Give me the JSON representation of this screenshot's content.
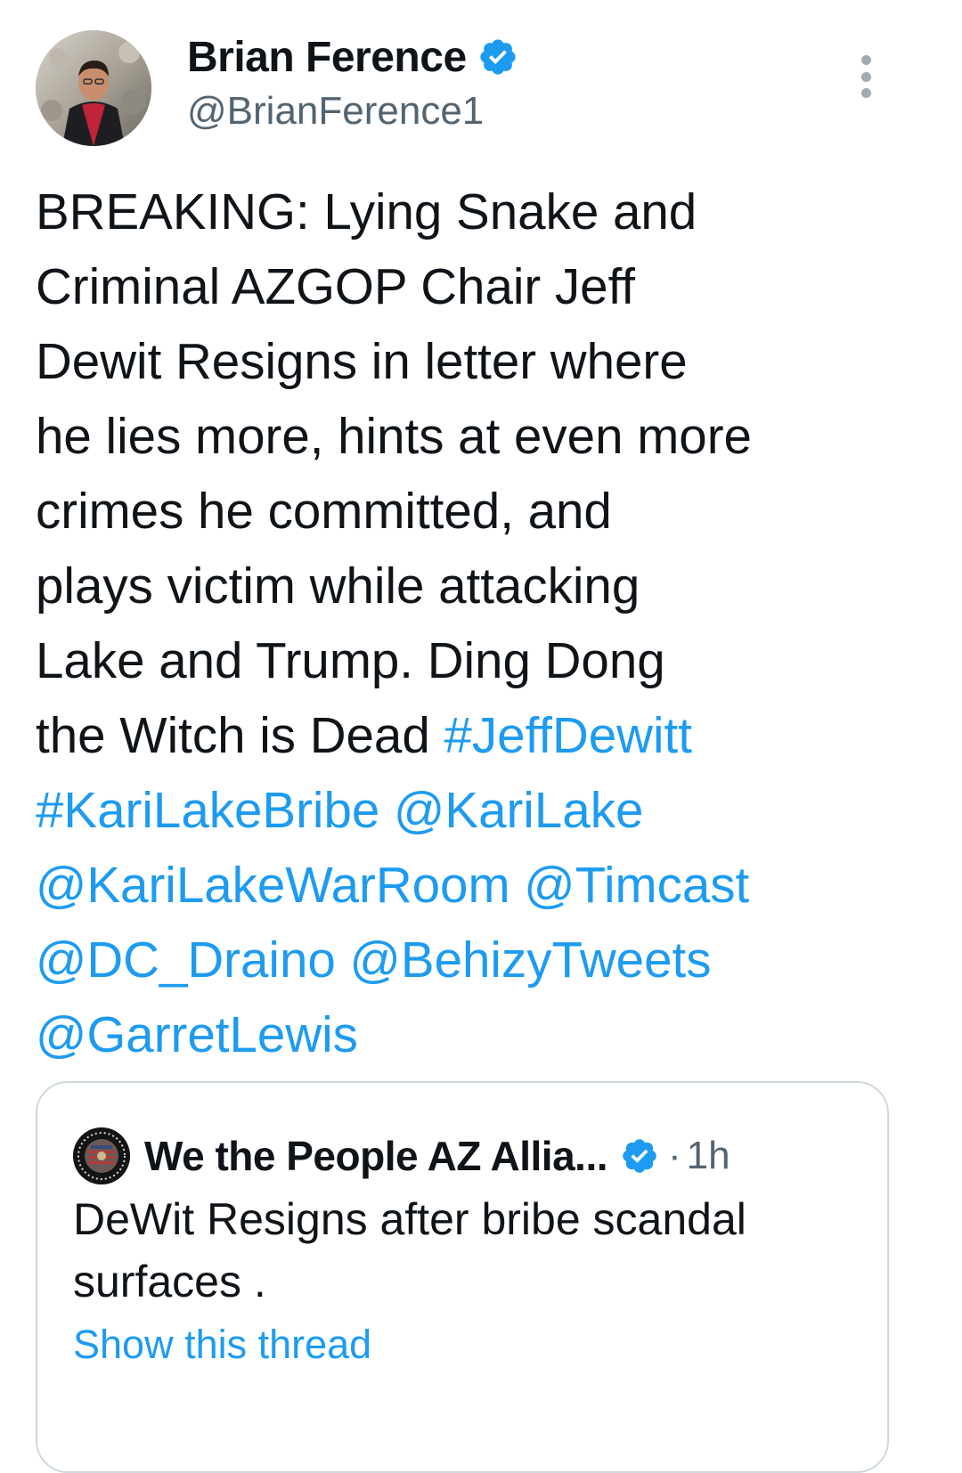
{
  "author": {
    "display_name": "Brian Ference",
    "handle": "@BrianFerence1",
    "verified": true,
    "avatar_icon": "profile-photo"
  },
  "tweet": {
    "lines": [
      {
        "segments": [
          {
            "text": "BREAKING: Lying Snake and",
            "type": "text"
          }
        ]
      },
      {
        "segments": [
          {
            "text": "Criminal AZGOP Chair Jeff",
            "type": "text"
          }
        ]
      },
      {
        "segments": [
          {
            "text": "Dewit Resigns in letter where",
            "type": "text"
          }
        ]
      },
      {
        "segments": [
          {
            "text": "he lies more, hints at even more",
            "type": "text"
          }
        ]
      },
      {
        "segments": [
          {
            "text": "crimes he committed, and",
            "type": "text"
          }
        ]
      },
      {
        "segments": [
          {
            "text": "plays victim while attacking",
            "type": "text"
          }
        ]
      },
      {
        "segments": [
          {
            "text": "Lake and Trump. Ding Dong",
            "type": "text"
          }
        ]
      },
      {
        "segments": [
          {
            "text": "the Witch is Dead ",
            "type": "text"
          },
          {
            "text": "#JeffDewitt",
            "type": "hashtag"
          }
        ]
      },
      {
        "segments": [
          {
            "text": "#KariLakeBribe",
            "type": "hashtag"
          },
          {
            "text": " ",
            "type": "text"
          },
          {
            "text": "@KariLake",
            "type": "mention"
          }
        ]
      },
      {
        "segments": [
          {
            "text": "@KariLakeWarRoom",
            "type": "mention"
          },
          {
            "text": " ",
            "type": "text"
          },
          {
            "text": "@Timcast",
            "type": "mention"
          }
        ]
      },
      {
        "segments": [
          {
            "text": "@DC_Draino",
            "type": "mention"
          },
          {
            "text": " ",
            "type": "text"
          },
          {
            "text": "@BehizyTweets",
            "type": "mention"
          }
        ]
      },
      {
        "segments": [
          {
            "text": "@GarretLewis",
            "type": "mention"
          }
        ]
      }
    ]
  },
  "quoted_tweet": {
    "display_name": "We the People AZ Allia...",
    "verified": true,
    "separator": "·",
    "time": "1h",
    "text_lines": [
      "DeWit Resigns after bribe scandal",
      "surfaces ."
    ],
    "show_thread_label": "Show this thread",
    "avatar_icon": "seal-logo"
  },
  "colors": {
    "link": "#1d9bf0",
    "text": "#0f1419",
    "secondary": "#536471",
    "border": "#cfd9de"
  }
}
